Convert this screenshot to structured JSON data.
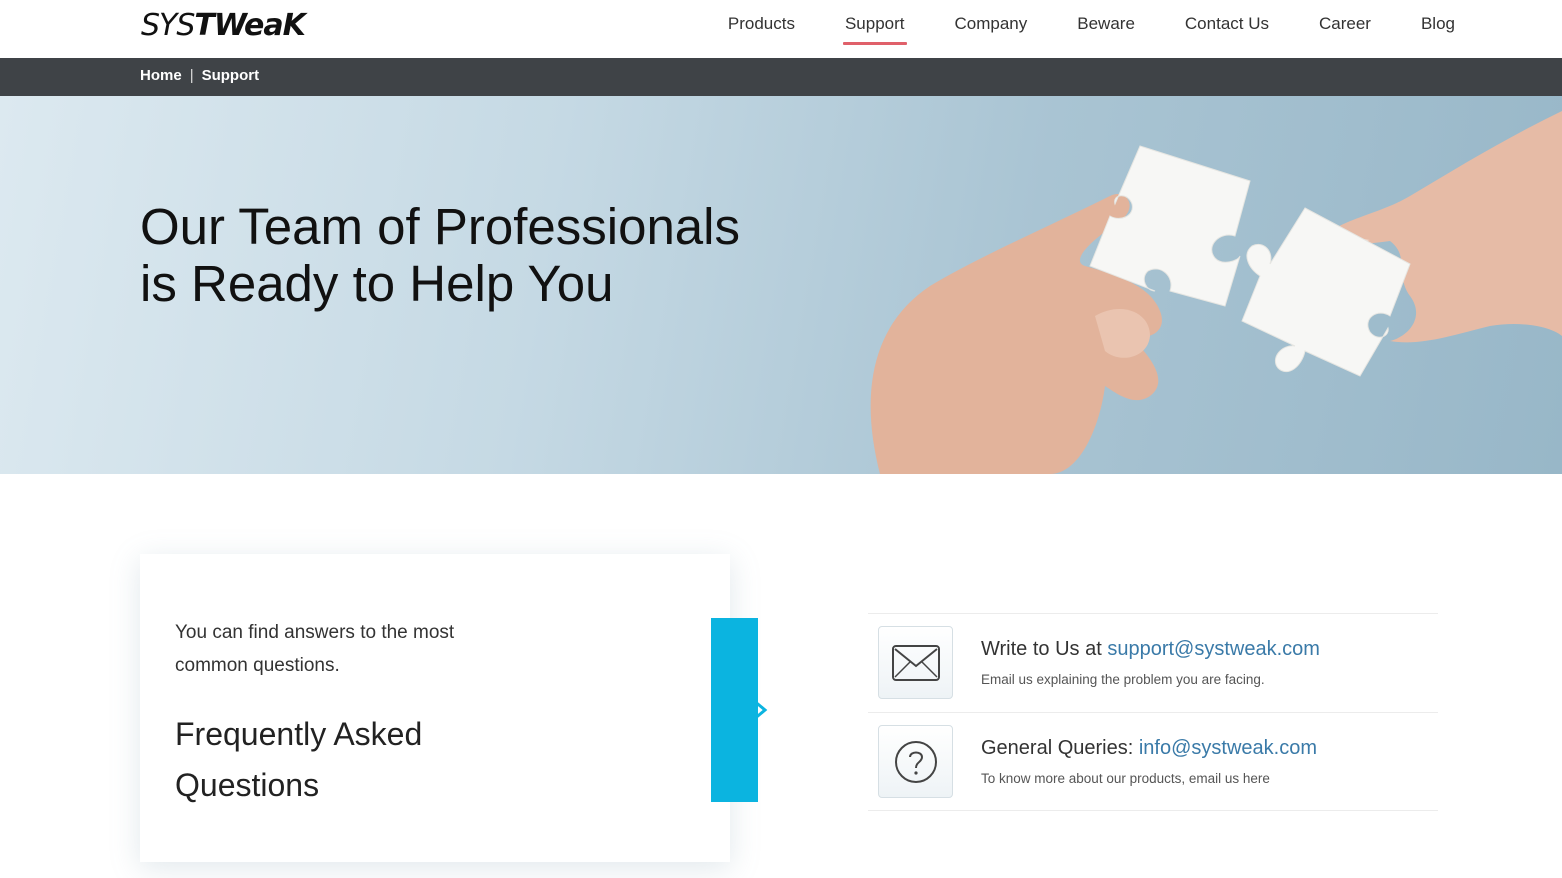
{
  "brand": {
    "logo_sys": "SYS",
    "logo_tweak": "TWeaK"
  },
  "nav": {
    "items": [
      {
        "label": "Products",
        "active": false
      },
      {
        "label": "Support",
        "active": true
      },
      {
        "label": "Company",
        "active": false
      },
      {
        "label": "Beware",
        "active": false
      },
      {
        "label": "Contact Us",
        "active": false
      },
      {
        "label": "Career",
        "active": false
      },
      {
        "label": "Blog",
        "active": false
      }
    ],
    "active_underline_color": "#e0606a"
  },
  "breadcrumb": {
    "home": "Home",
    "separator": "|",
    "current": "Support"
  },
  "hero": {
    "title_line1": "Our Team of Professionals",
    "title_line2": "is Ready to Help You",
    "image": "hands-puzzle-pieces"
  },
  "faq": {
    "text": "You can find answers to the most common questions.",
    "title": "Frequently Asked Questions",
    "accent_color": "#0bb4e0"
  },
  "contacts": [
    {
      "icon": "envelope-icon",
      "label": "Write to Us at",
      "email": "support@systweak.com",
      "sub": "Email us explaining the problem you are facing."
    },
    {
      "icon": "question-icon",
      "label": "General Queries:",
      "email": "info@systweak.com",
      "sub": "To know more about our products, email us here"
    }
  ]
}
